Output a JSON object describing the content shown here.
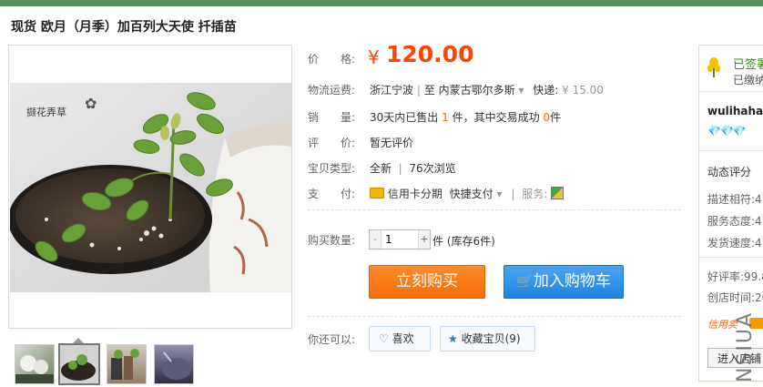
{
  "title": "现货 欧月（月季）加百列大天使 扦插苗",
  "price": {
    "label": "价　　格:",
    "symbol": "¥",
    "value": "120.00"
  },
  "shipping": {
    "label": "物流运费:",
    "from": "浙江宁波",
    "separator": "至",
    "to": "内蒙古鄂尔多斯",
    "method_label": "快递:",
    "fee": "¥ 15.00"
  },
  "sales": {
    "label": "销　　量:",
    "prefix": "30天内已售出",
    "sold": "1",
    "mid": "件，其中交易成功",
    "success": "0",
    "suffix": "件"
  },
  "rating": {
    "label": "评　　价:",
    "value": "暂无评价"
  },
  "item_type": {
    "label": "宝贝类型:",
    "condition": "全新",
    "views": "76次浏览"
  },
  "payment": {
    "label": "支　　付:",
    "credit": "信用卡分期",
    "quick": "快捷支付",
    "service_label": "服务:"
  },
  "quantity": {
    "label": "购买数量:",
    "value": "1",
    "minus": "-",
    "plus": "+",
    "unit": "件",
    "stock": "(库存6件)"
  },
  "buttons": {
    "buy_now": "立刻购买",
    "add_to_cart": "加入购物车"
  },
  "extras": {
    "label": "你还可以:",
    "like": "喜欢",
    "favorite": "收藏宝贝",
    "favorite_count": "(9)"
  },
  "photo_watermark": "撷花弄草",
  "seller": {
    "badge_title": "已签署",
    "badge_sub": "已缴纳",
    "name": "wulihaha",
    "dynamic_label": "动态评分",
    "desc": "描述相符:4",
    "service": "服务态度:4",
    "shipping_speed": "发货速度:4",
    "positive": "好评率:99.8",
    "opened": "创店时间:20",
    "credit": "信用卖",
    "enter_shop": "进入店铺"
  },
  "watermark": "NSIUA",
  "colors": {
    "price": "#ff4400",
    "buy_button": "#f46d0b",
    "cart_button": "#1f84df",
    "top_bar": "#5e8f62",
    "link": "#2a7ab8"
  },
  "icons": {
    "credit_card": "credit-card-icon",
    "cart": "cart-icon",
    "heart": "heart-icon",
    "star": "star-icon",
    "wheat": "wheat-icon",
    "diamond": "diamond-icon"
  }
}
